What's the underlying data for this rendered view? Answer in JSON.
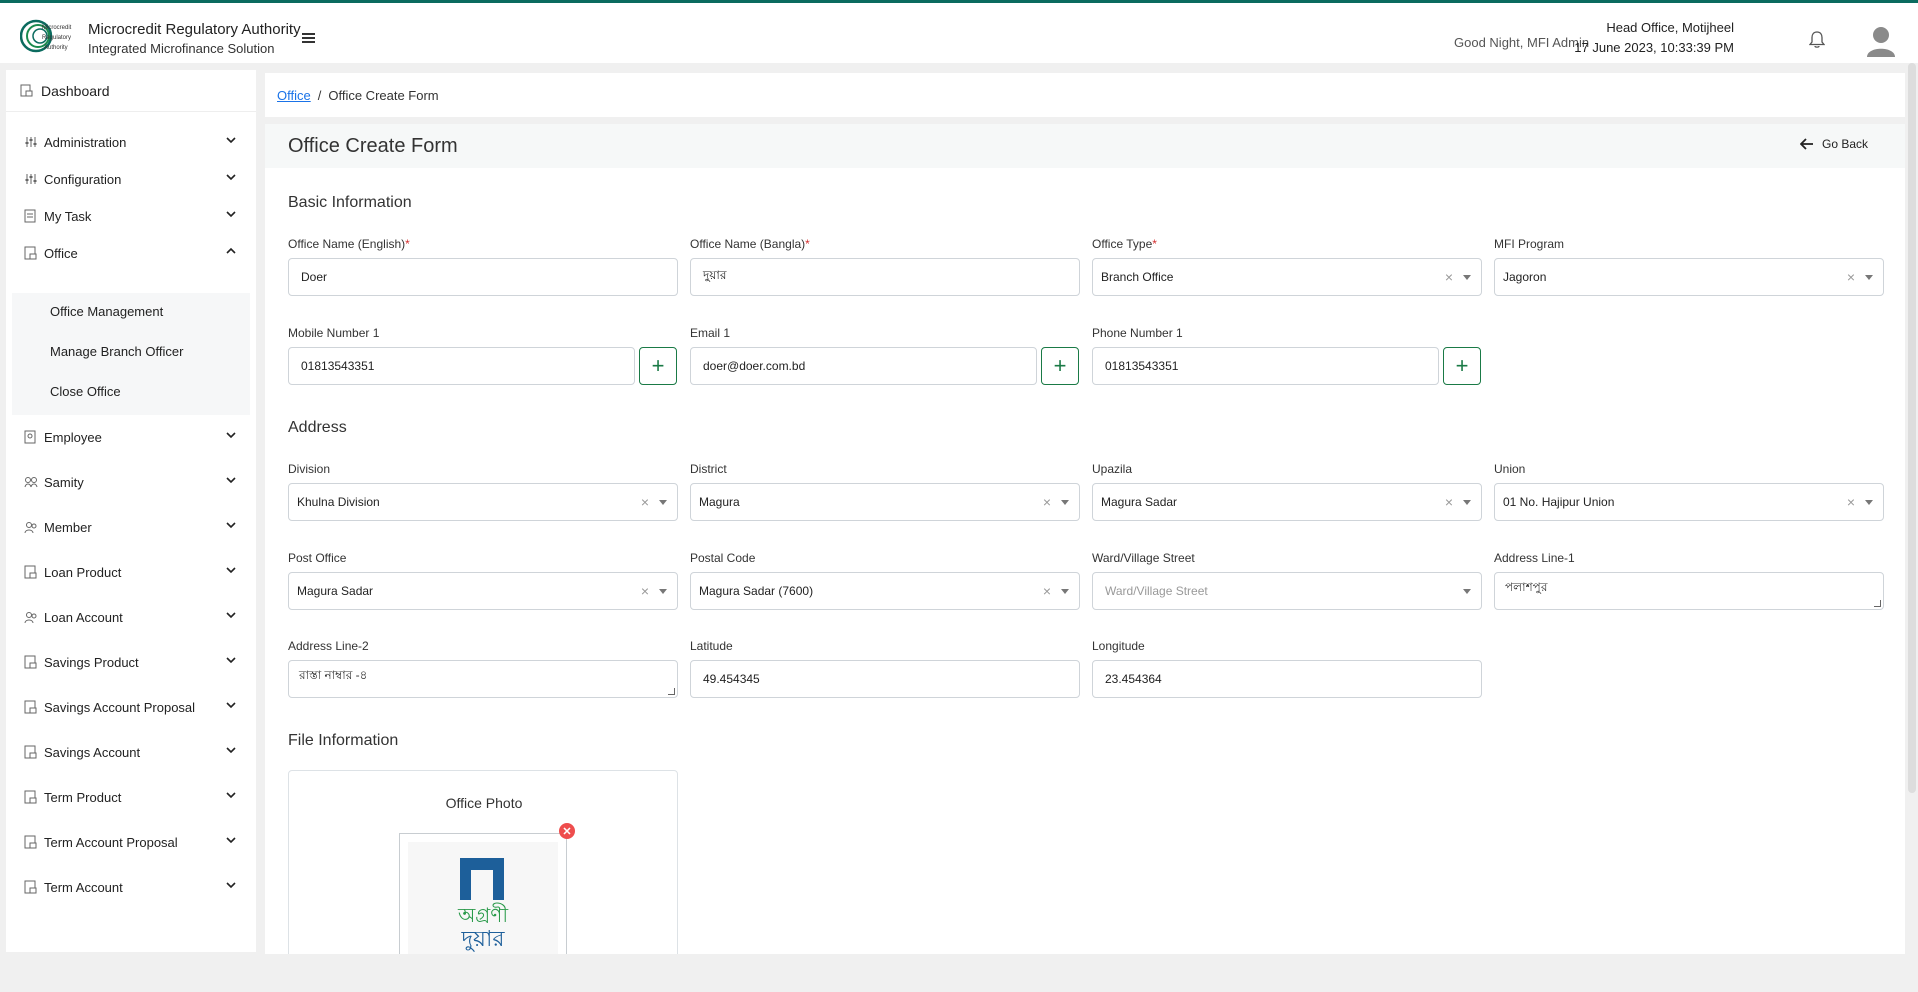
{
  "header": {
    "org_title": "Microcredit Regulatory Authority",
    "org_subtitle": "Integrated Microfinance Solution",
    "logo_text": "Microcredit Regulatory Authority",
    "greeting": "Good Night, MFI Admin",
    "office_name": "Head Office, Motijheel",
    "datetime": "17 June 2023, 10:33:39 PM",
    "brand_color": "#0b6b5f"
  },
  "sidebar": {
    "dashboard": "Dashboard",
    "items": [
      {
        "label": "Administration",
        "icon": "sliders-icon"
      },
      {
        "label": "Configuration",
        "icon": "sliders-icon"
      },
      {
        "label": "My Task",
        "icon": "task-icon"
      },
      {
        "label": "Office",
        "icon": "office-icon",
        "expanded": true
      },
      {
        "label": "Employee",
        "icon": "employee-icon"
      },
      {
        "label": "Samity",
        "icon": "samity-icon"
      },
      {
        "label": "Member",
        "icon": "member-icon"
      },
      {
        "label": "Loan Product",
        "icon": "product-icon"
      },
      {
        "label": "Loan Account",
        "icon": "account-icon"
      },
      {
        "label": "Savings Product",
        "icon": "product-icon"
      },
      {
        "label": "Savings Account Proposal",
        "icon": "product-icon"
      },
      {
        "label": "Savings Account",
        "icon": "product-icon"
      },
      {
        "label": "Term Product",
        "icon": "product-icon"
      },
      {
        "label": "Term Account Proposal",
        "icon": "product-icon"
      },
      {
        "label": "Term Account",
        "icon": "product-icon"
      }
    ],
    "office_sub": [
      "Office Management",
      "Manage Branch Officer",
      "Close Office"
    ]
  },
  "breadcrumb": {
    "link": "Office",
    "separator": "/",
    "current": "Office Create Form"
  },
  "form": {
    "title": "Office Create Form",
    "go_back": "Go Back",
    "basic_info_title": "Basic Information",
    "address_title": "Address",
    "file_info_title": "File Information",
    "fields": {
      "office_name_en": {
        "label": "Office Name (English)",
        "value": "Doer",
        "required": "*"
      },
      "office_name_bn": {
        "label": "Office Name (Bangla)",
        "value": "দুয়ার",
        "required": "*"
      },
      "office_type": {
        "label": "Office Type",
        "value": "Branch Office",
        "required": "*"
      },
      "mfi_program": {
        "label": "MFI Program",
        "value": "Jagoron"
      },
      "mobile1": {
        "label": "Mobile Number 1",
        "value": "01813543351"
      },
      "email1": {
        "label": "Email 1",
        "value": "doer@doer.com.bd"
      },
      "phone1": {
        "label": "Phone Number 1",
        "value": "01813543351"
      },
      "division": {
        "label": "Division",
        "value": "Khulna Division"
      },
      "district": {
        "label": "District",
        "value": "Magura"
      },
      "upazila": {
        "label": "Upazila",
        "value": "Magura Sadar"
      },
      "union": {
        "label": "Union",
        "value": "01 No. Hajipur Union"
      },
      "post_office": {
        "label": "Post Office",
        "value": "Magura Sadar"
      },
      "postal_code": {
        "label": "Postal Code",
        "value": "Magura Sadar (7600)"
      },
      "ward": {
        "label": "Ward/Village Street",
        "placeholder": "Ward/Village Street"
      },
      "address1": {
        "label": "Address Line-1",
        "value": "পলাশপুর"
      },
      "address2": {
        "label": "Address Line-2",
        "value": "রাস্তা নাম্বার -৪"
      },
      "latitude": {
        "label": "Latitude",
        "value": "49.454345"
      },
      "longitude": {
        "label": "Longitude",
        "value": "23.454364"
      }
    },
    "photo": {
      "title": "Office Photo",
      "logo_line1": "অগ্রণী",
      "logo_line2": "দুয়ার"
    },
    "add_symbol": "+",
    "clear_symbol": "×"
  }
}
